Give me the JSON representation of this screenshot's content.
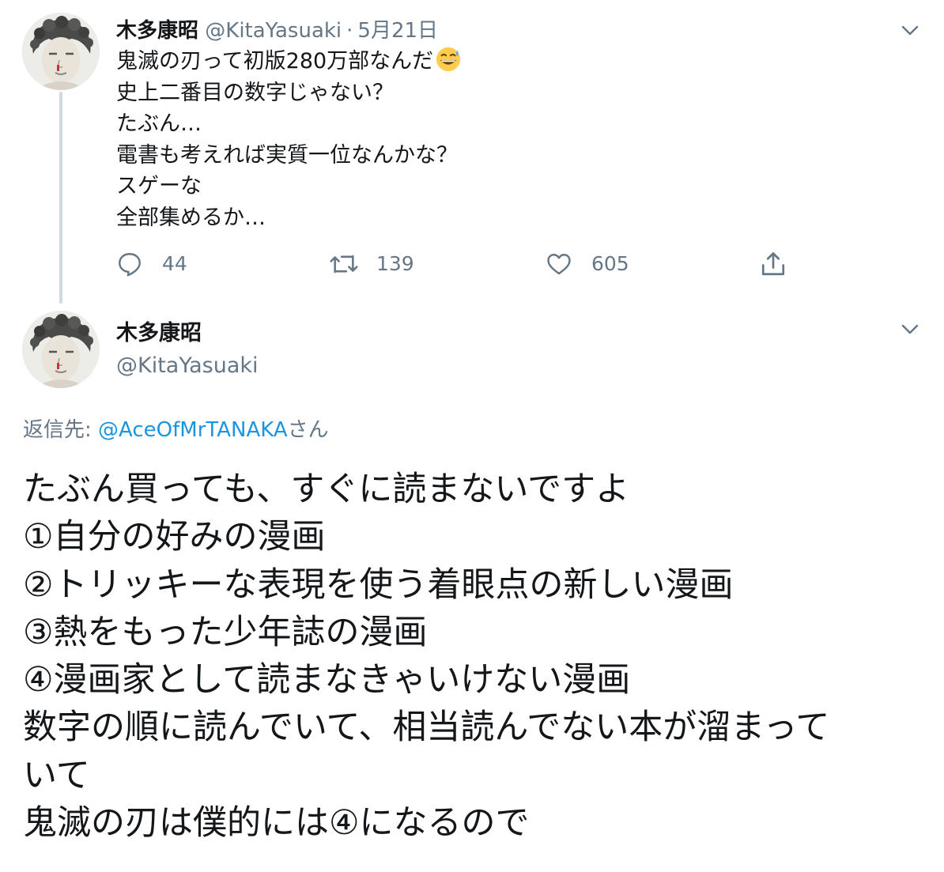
{
  "tweet1": {
    "author_name": "木多康昭",
    "author_handle": "@KitaYasuaki",
    "separator": "·",
    "date": "5月21日",
    "lines": [
      "鬼滅の刃って初版280万部なんだ",
      "史上二番目の数字じゃない？",
      "たぶん…",
      "電書も考えれば実質一位なんかな？",
      "スゲーな",
      "全部集めるか…"
    ],
    "emoji": "grinning-face-with-sweat",
    "actions": {
      "reply_count": "44",
      "retweet_count": "139",
      "like_count": "605"
    }
  },
  "tweet2": {
    "author_name": "木多康昭",
    "author_handle": "@KitaYasuaki",
    "reply_to_label": "返信先: ",
    "reply_to_mention": "@AceOfMrTANAKA",
    "reply_to_suffix": "さん",
    "lines": [
      "たぶん買っても、すぐに読まないですよ",
      "①自分の好みの漫画",
      "②トリッキーな表現を使う着眼点の新しい漫画",
      "③熱をもった少年誌の漫画",
      "④漫画家として読まなきゃいけない漫画",
      "数字の順に読んでいて、相当読んでない本が溜まって",
      "いて",
      "鬼滅の刃は僕的には④になるので"
    ]
  },
  "colors": {
    "text": "#14171a",
    "secondary": "#657786",
    "link": "#1b95e0",
    "thread_line": "#cfd9de"
  }
}
